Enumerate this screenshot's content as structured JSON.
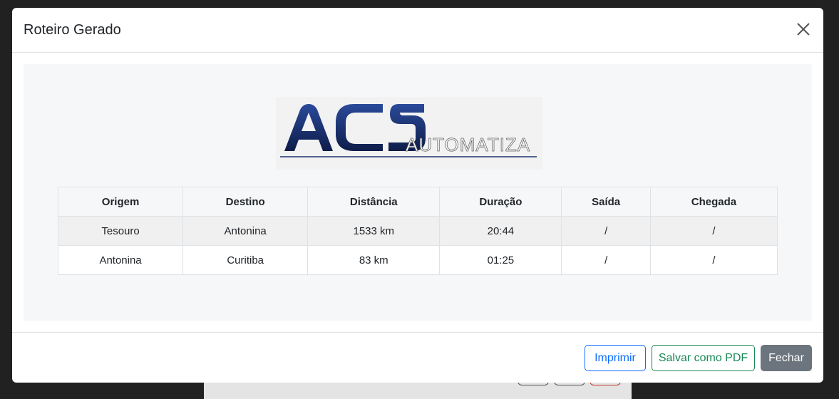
{
  "modal": {
    "title": "Roteiro Gerado",
    "close_icon": "close-icon"
  },
  "logo": {
    "text_main": "ACS",
    "text_sub": "AUTOMATIZA"
  },
  "table": {
    "headers": [
      "Origem",
      "Destino",
      "Distância",
      "Duração",
      "Saída",
      "Chegada"
    ],
    "rows": [
      [
        "Tesouro",
        "Antonina",
        "1533 km",
        "20:44",
        "/",
        "/"
      ],
      [
        "Antonina",
        "Curitiba",
        "83 km",
        "01:25",
        "/",
        "/"
      ]
    ]
  },
  "footer": {
    "print_label": "Imprimir",
    "pdf_label": "Salvar como PDF",
    "close_label": "Fechar"
  },
  "colors": {
    "primary": "#0d6efd",
    "success": "#198754",
    "secondary": "#6c757d",
    "logo_navy": "#1a2f6e"
  }
}
